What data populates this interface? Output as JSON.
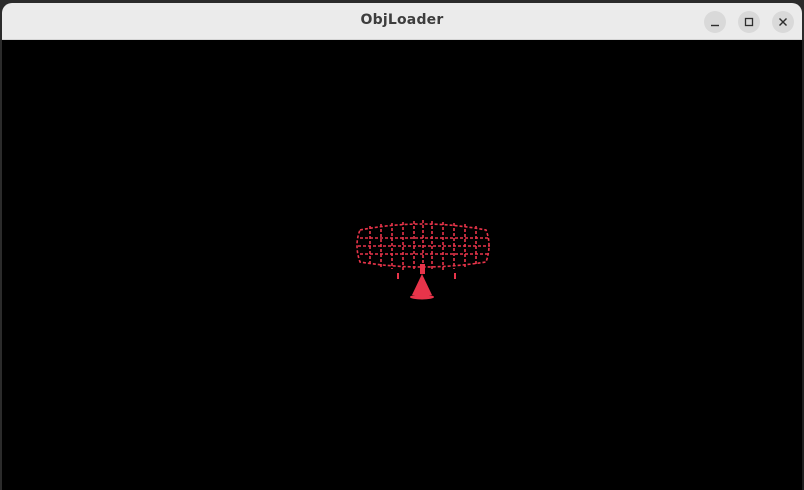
{
  "window": {
    "title": "ObjLoader"
  },
  "controls": {
    "minimize_icon": "minimize-icon",
    "maximize_icon": "maximize-icon",
    "close_icon": "close-icon"
  },
  "colors": {
    "titlebar": "#ebebeb",
    "viewport_background": "#000000",
    "model_wireframe": "#e8344a"
  }
}
